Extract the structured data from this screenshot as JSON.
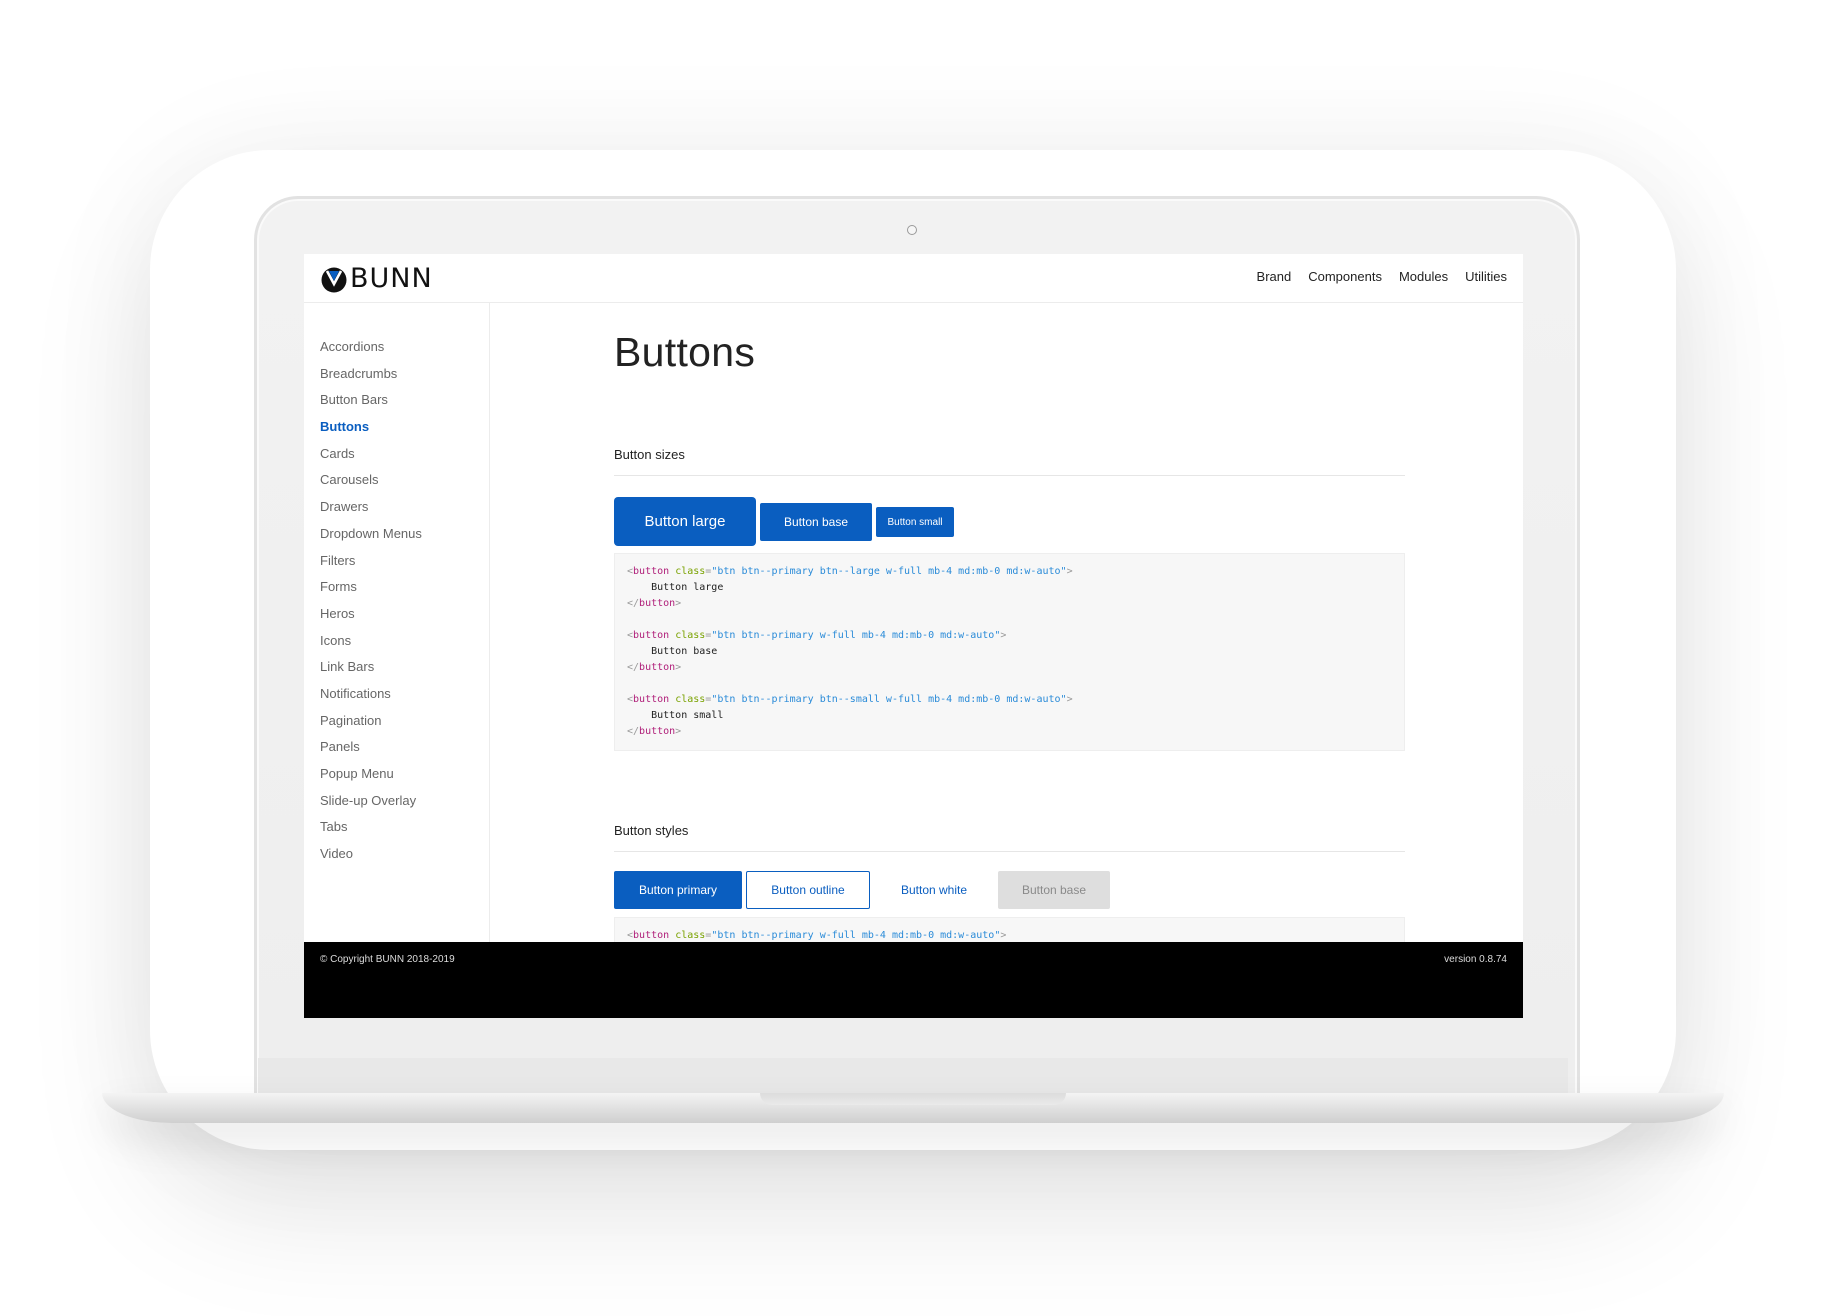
{
  "brand": {
    "name": "BUNN"
  },
  "topnav": {
    "items": [
      "Brand",
      "Components",
      "Modules",
      "Utilities"
    ]
  },
  "sidebar": {
    "items": [
      {
        "label": "Accordions"
      },
      {
        "label": "Breadcrumbs"
      },
      {
        "label": "Button Bars"
      },
      {
        "label": "Buttons",
        "active": true
      },
      {
        "label": "Cards"
      },
      {
        "label": "Carousels"
      },
      {
        "label": "Drawers"
      },
      {
        "label": "Dropdown Menus"
      },
      {
        "label": "Filters"
      },
      {
        "label": "Forms"
      },
      {
        "label": "Heros"
      },
      {
        "label": "Icons"
      },
      {
        "label": "Link Bars"
      },
      {
        "label": "Notifications"
      },
      {
        "label": "Pagination"
      },
      {
        "label": "Panels"
      },
      {
        "label": "Popup Menu"
      },
      {
        "label": "Slide-up Overlay"
      },
      {
        "label": "Tabs"
      },
      {
        "label": "Video"
      }
    ]
  },
  "main": {
    "title": "Buttons",
    "sizes": {
      "heading": "Button sizes",
      "buttons": {
        "large": "Button large",
        "base": "Button base",
        "small": "Button small"
      },
      "code": [
        {
          "class": "btn btn--primary btn--large w-full mb-4 md:mb-0 md:w-auto",
          "text": "Button large"
        },
        {
          "class": "btn btn--primary w-full mb-4 md:mb-0 md:w-auto",
          "text": "Button base"
        },
        {
          "class": "btn btn--primary btn--small w-full mb-4 md:mb-0 md:w-auto",
          "text": "Button small"
        }
      ]
    },
    "styles": {
      "heading": "Button styles",
      "buttons": {
        "primary": "Button primary",
        "outline": "Button outline",
        "white": "Button white",
        "base": "Button base"
      },
      "code_partial": {
        "class": "btn btn--primary w-full mb-4 md:mb-0 md:w-auto"
      }
    }
  },
  "footer": {
    "copyright": "© Copyright BUNN 2018-2019",
    "version": "version 0.8.74"
  },
  "colors": {
    "primary": "#0a5ec0",
    "footer_bg": "#000000",
    "disabled_bg": "#dedede"
  }
}
